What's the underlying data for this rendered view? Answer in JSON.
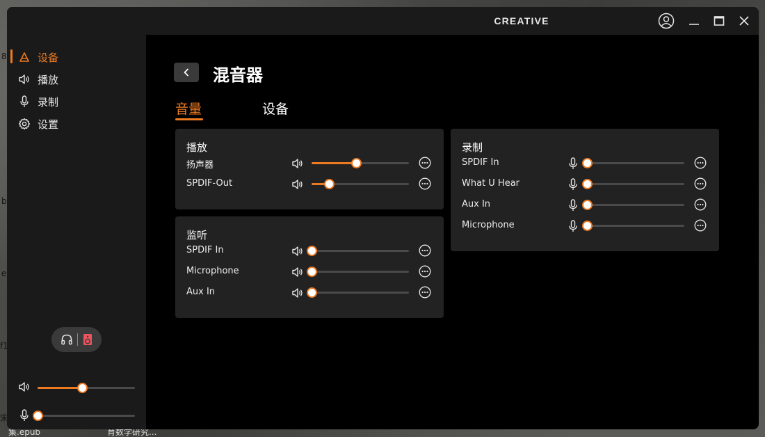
{
  "desktop": {
    "fragments": [
      "8",
      "b",
      "e",
      "f1",
      "宋",
      "集.epub",
      "育数学研究..."
    ]
  },
  "window": {
    "brand": "CREATIVE"
  },
  "sidebar": {
    "items": [
      {
        "label": "设备",
        "icon": "device-icon",
        "active": true
      },
      {
        "label": "播放",
        "icon": "speaker-icon",
        "active": false
      },
      {
        "label": "录制",
        "icon": "microphone-icon",
        "active": false
      },
      {
        "label": "设置",
        "icon": "gear-icon",
        "active": false
      }
    ],
    "master_output_level": 0.46,
    "master_input_level": 0.0
  },
  "header": {
    "title": "混音器"
  },
  "tabs": [
    {
      "label": "音量",
      "active": true
    },
    {
      "label": "设备",
      "active": false
    }
  ],
  "playback_card": {
    "title": "播放",
    "rows": [
      {
        "label": "扬声器",
        "level": 0.46
      },
      {
        "label": "SPDIF-Out",
        "level": 0.18
      }
    ]
  },
  "monitor_card": {
    "title": "监听",
    "rows": [
      {
        "label": "SPDIF In",
        "level": 0.0
      },
      {
        "label": "Microphone",
        "level": 0.0
      },
      {
        "label": "Aux In",
        "level": 0.0
      }
    ]
  },
  "record_card": {
    "title": "录制",
    "rows": [
      {
        "label": "SPDIF In",
        "level": 0.0
      },
      {
        "label": "What U Hear",
        "level": 0.0
      },
      {
        "label": "Aux In",
        "level": 0.0
      },
      {
        "label": "Microphone",
        "level": 0.0
      }
    ]
  },
  "colors": {
    "accent": "#ee7a22",
    "headset_accent": "#e8555e"
  }
}
